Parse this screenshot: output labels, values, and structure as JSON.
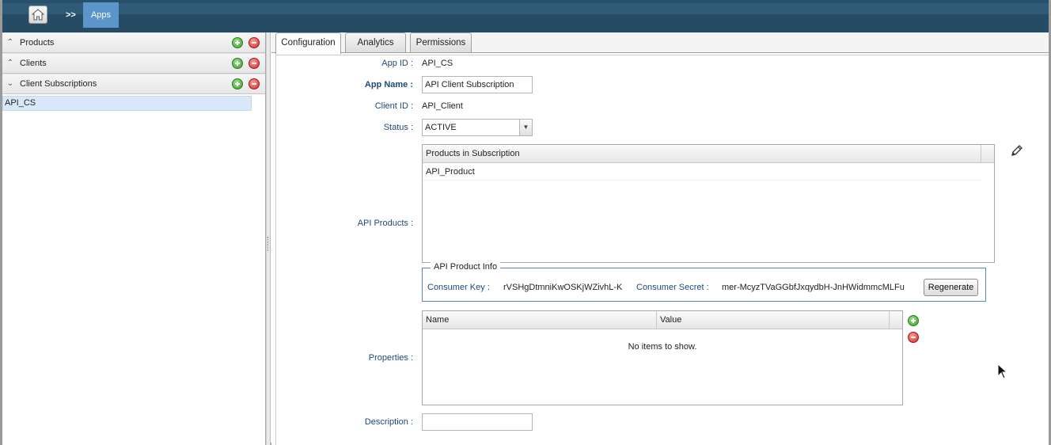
{
  "breadcrumb": {
    "separator": ">>",
    "current": "Apps"
  },
  "sidebar": {
    "sections": [
      {
        "label": "Products",
        "expanded": false
      },
      {
        "label": "Clients",
        "expanded": false
      },
      {
        "label": "Client Subscriptions",
        "expanded": true
      }
    ],
    "items": [
      "API_CS"
    ]
  },
  "tabs": [
    {
      "label": "Configuration",
      "active": true
    },
    {
      "label": "Analytics",
      "active": false
    },
    {
      "label": "Permissions",
      "active": false
    }
  ],
  "form": {
    "app_id_label": "App ID :",
    "app_id_value": "API_CS",
    "app_name_label": "App Name :",
    "app_name_value": "API Client Subscription",
    "client_id_label": "Client ID :",
    "client_id_value": "API_Client",
    "status_label": "Status :",
    "status_value": "ACTIVE",
    "api_products_label": "API Products :",
    "products_grid": {
      "header": "Products in Subscription",
      "rows": [
        "API_Product"
      ]
    },
    "product_info": {
      "legend": "API Product Info",
      "consumer_key_label": "Consumer Key :",
      "consumer_key_value": "rVSHgDtmniKwOSKjWZivhL-K",
      "consumer_secret_label": "Consumer Secret :",
      "consumer_secret_value": "mer-McyzTVaGGbfJxqydbH-JnHWidmmcMLFu",
      "regenerate_label": "Regenerate"
    },
    "properties_label": "Properties :",
    "properties_grid": {
      "columns": [
        "Name",
        "Value"
      ],
      "empty_text": "No items to show."
    },
    "description_label": "Description :",
    "description_value": ""
  },
  "colors": {
    "topbar": "#2f5a78",
    "breadcrumb_active": "#5b95c9",
    "label_text": "#1e4a7a",
    "selected_row": "#d9e8f8",
    "fieldset_border": "#5a87b8"
  }
}
